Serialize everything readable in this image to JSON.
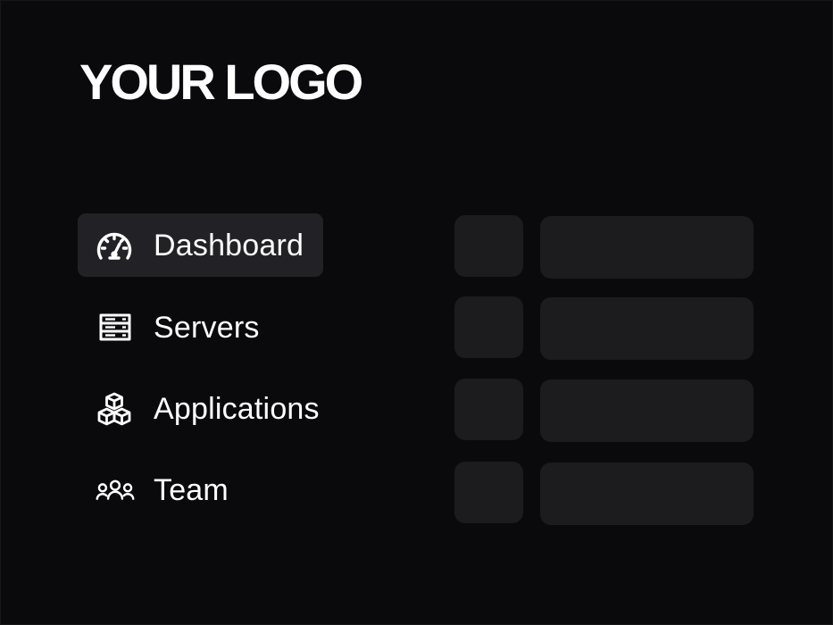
{
  "logo": {
    "text": "YOUR LOGO"
  },
  "sidebar": {
    "items": [
      {
        "label": "Dashboard",
        "icon": "speedometer-icon",
        "active": true
      },
      {
        "label": "Servers",
        "icon": "server-icon",
        "active": false
      },
      {
        "label": "Applications",
        "icon": "cubes-icon",
        "active": false
      },
      {
        "label": "Team",
        "icon": "team-icon",
        "active": false
      }
    ]
  },
  "colors": {
    "background": "#0a0a0c",
    "active_item": "#222226",
    "placeholder": "#1c1c1f",
    "text": "#ffffff"
  }
}
